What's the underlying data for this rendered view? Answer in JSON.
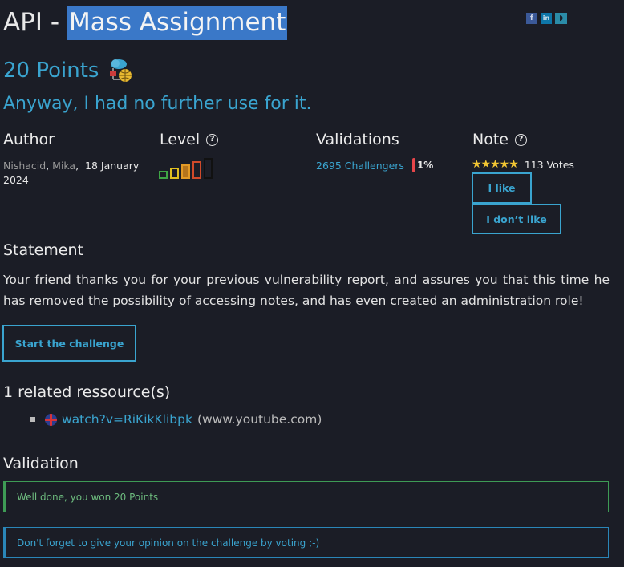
{
  "header": {
    "title_prefix": "API - ",
    "title_highlight": "Mass Assignment",
    "share_icons": [
      "facebook-icon",
      "linkedin-icon",
      "mastodon-icon"
    ]
  },
  "points": "20 Points",
  "points_icon": "cloud-network-icon",
  "subtitle": "Anyway, I had no further use for it.",
  "columns": {
    "author_title": "Author",
    "level_title": "Level",
    "validations_title": "Validations",
    "note_title": "Note"
  },
  "author": {
    "names": [
      "Nishacid",
      "Mika"
    ],
    "date": "18 January 2024"
  },
  "level": {
    "current": 4,
    "max": 5,
    "colors": [
      "#3ea545",
      "#e0c020",
      "#e39a25",
      "#d04a2a",
      "#2a2a2a"
    ]
  },
  "validations": {
    "challengers": "2695 Challengers",
    "percent": "1%"
  },
  "note": {
    "stars": 5,
    "votes": "113 Votes",
    "like_label": "I like",
    "dislike_label": "I don’t like"
  },
  "statement": {
    "heading": "Statement",
    "text": "Your friend thanks you for your previous vulnerability report, and assures you that this time he has removed the possibility of accessing notes, and has even created an administration role!"
  },
  "start_button": "Start the challenge",
  "resources": {
    "heading": "1 related ressource(s)",
    "items": [
      {
        "link": "watch?v=RiKikKlibpk",
        "domain": "(www.youtube.com)",
        "flag": "uk-flag-icon"
      }
    ]
  },
  "validation": {
    "heading": "Validation",
    "success": "Well done, you won 20 Points",
    "info": "Don't forget to give your opinion on the challenge by voting ;-)"
  }
}
